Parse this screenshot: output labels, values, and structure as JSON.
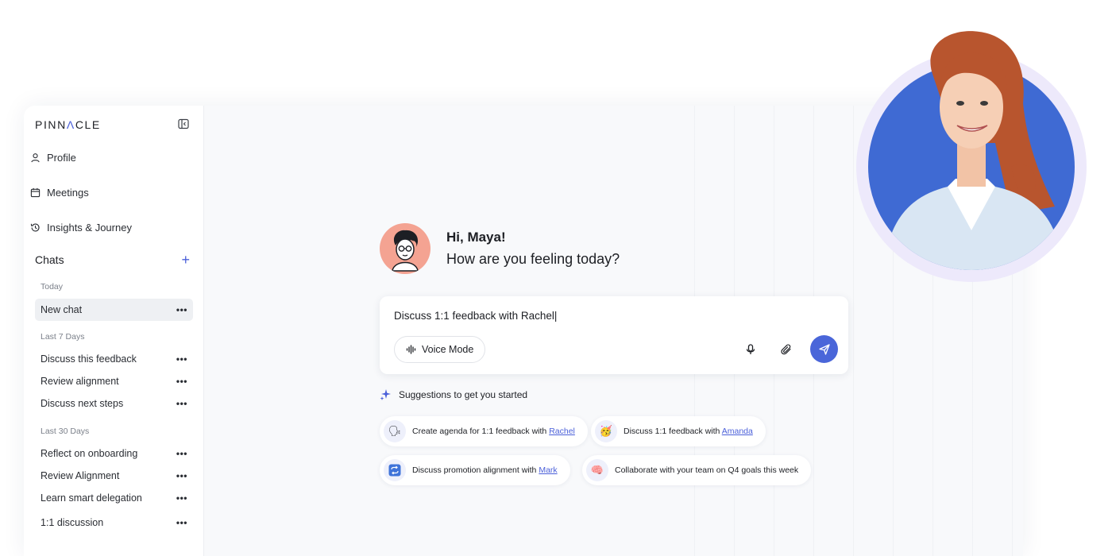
{
  "sidebar": {
    "logo": "PINN",
    "logo_tri": "Λ",
    "logo_end": "CLE",
    "nav": [
      {
        "label": "Profile",
        "icon": "user-icon"
      },
      {
        "label": "Meetings",
        "icon": "calendar-icon"
      },
      {
        "label": "Insights & Journey",
        "icon": "history-icon"
      }
    ],
    "chats_title": "Chats",
    "groups": {
      "today": "Today",
      "last7": "Last 7 Days",
      "last30": "Last 30 Days"
    },
    "chats": {
      "today": [
        "New chat"
      ],
      "last7": [
        "Discuss this feedback",
        "Review alignment",
        "Discuss next steps"
      ],
      "last30": [
        "Reflect on onboarding",
        "Review Alignment",
        "Learn smart delegation",
        "1:1 discussion"
      ]
    },
    "more": "•••"
  },
  "greeting": {
    "name": "Hi, Maya!",
    "question": "How are you feeling today?"
  },
  "composer": {
    "value": "Discuss 1:1 feedback with Rachel|",
    "voice_label": "Voice Mode"
  },
  "suggestions": {
    "title": "Suggestions to get you started",
    "items": [
      {
        "text": "Create agenda for 1:1 feedback with ",
        "name": "Rachel",
        "icon": "speaking-head-icon"
      },
      {
        "text": "Discuss 1:1 feedback with ",
        "name": "Amanda",
        "icon": "party-face-icon"
      },
      {
        "text": "Discuss promotion alignment with ",
        "name": "Mark",
        "icon": "repeat-icon"
      },
      {
        "text": "Collaborate with your team on Q4 goals this week",
        "name": "",
        "icon": "brain-icon"
      }
    ]
  },
  "colors": {
    "accent": "#4a66d9",
    "avatar_bg": "#f4a392",
    "photo_bg": "#3f6ad3"
  }
}
